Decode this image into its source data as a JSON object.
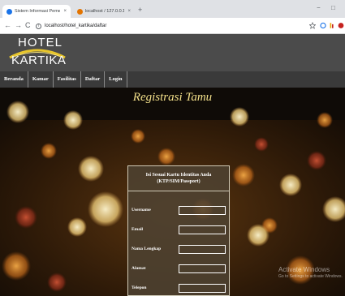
{
  "browser": {
    "tabs": [
      {
        "title": "Sistem Informasi Pemesanan Ka",
        "close": "×",
        "favicon_color": "#1a73e8"
      },
      {
        "title": "localhost / 127.0.0.1 / xathotel",
        "close": "×",
        "favicon_color": "#e37400"
      }
    ],
    "new_tab": "+",
    "window_controls": {
      "minimize": "−",
      "maximize": "□"
    },
    "address": "localhost/hotel_kartika/daftar",
    "nav": {
      "back": "←",
      "forward": "→",
      "reload": "C"
    }
  },
  "site": {
    "logo": {
      "top": "HOTEL",
      "bottom": "KARTIKA"
    },
    "nav": [
      "Beranda",
      "Kamar",
      "Fasilitas",
      "Daftar",
      "Login"
    ]
  },
  "page": {
    "heading": "Registrasi Tamu",
    "form": {
      "title_line1": "Isi Sesuai Kartu Identitas Anda",
      "title_line2": "(KTP/SIM/Passport)",
      "fields": [
        {
          "label": "Username",
          "value": ""
        },
        {
          "label": "Email",
          "value": ""
        },
        {
          "label": "Nama Lengkap",
          "value": ""
        },
        {
          "label": "Alamat",
          "value": ""
        },
        {
          "label": "Telepon",
          "value": ""
        }
      ]
    }
  },
  "watermark": {
    "title": "Activate Windows",
    "subtitle": "Go to Settings to activate Windows."
  },
  "colors": {
    "header_bg": "#4b4b4b",
    "nav_bg": "#3a3a3a",
    "heading": "#f3e08a",
    "logo_arc": "#e8c62c"
  }
}
